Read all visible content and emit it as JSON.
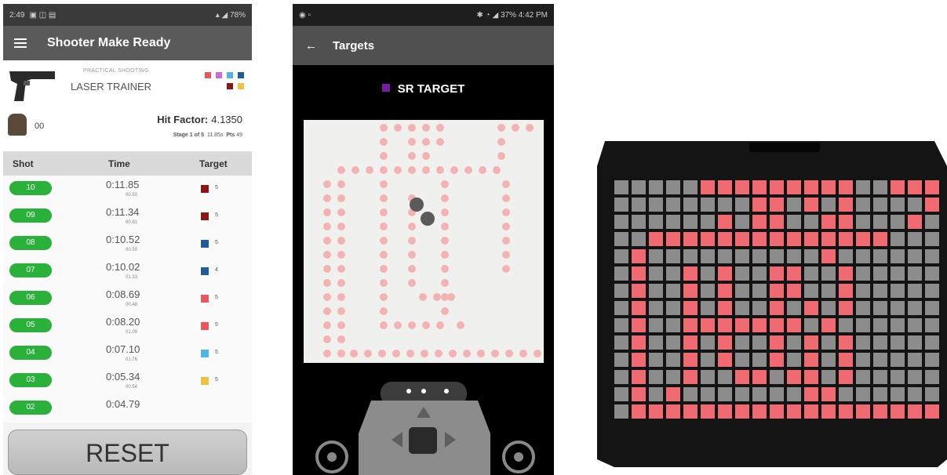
{
  "phone1": {
    "status": {
      "time": "2:49",
      "battery": "78%"
    },
    "app_title": "Shooter Make Ready",
    "subtitle": "PRACTICAL SHOOTING",
    "mode": "LASER TRAINER",
    "score": "00",
    "hit_factor_label": "Hit Factor:",
    "hit_factor": "4.1350",
    "stage": "Stage 1 of 5",
    "total_time": "11.85s",
    "pts_label": "Pts",
    "pts": "49",
    "headers": {
      "shot": "Shot",
      "time": "Time",
      "target": "Target"
    },
    "colors": [
      "#e8585e",
      "#c86cd6",
      "#4fb4e6",
      "#1e5c9a",
      "#8c1616",
      "#f2c040"
    ],
    "shots": [
      {
        "num": "10",
        "time": "0:11.85",
        "split": "00.50",
        "color": "#8c1616",
        "target": "5"
      },
      {
        "num": "09",
        "time": "0:11.34",
        "split": "00.81",
        "color": "#8c1616",
        "target": "5"
      },
      {
        "num": "08",
        "time": "0:10.52",
        "split": "00.50",
        "color": "#1e5c9a",
        "target": "5"
      },
      {
        "num": "07",
        "time": "0:10.02",
        "split": "01.33",
        "color": "#1e5c9a",
        "target": "4"
      },
      {
        "num": "06",
        "time": "0:08.69",
        "split": "00.48",
        "color": "#e8585e",
        "target": "5"
      },
      {
        "num": "05",
        "time": "0:08.20",
        "split": "01.09",
        "color": "#e8585e",
        "target": "5"
      },
      {
        "num": "04",
        "time": "0:07.10",
        "split": "01.76",
        "color": "#4fb4e6",
        "target": "5"
      },
      {
        "num": "03",
        "time": "0:05.34",
        "split": "00.54",
        "color": "#f2c040",
        "target": "5"
      },
      {
        "num": "02",
        "time": "0:04.79",
        "split": "",
        "color": "#cccccc",
        "target": ""
      }
    ],
    "reset_label": "RESET"
  },
  "phone2": {
    "status": {
      "time": "4:42 PM",
      "battery": "37%"
    },
    "app_title": "Targets",
    "target_title": "SR TARGET",
    "target_color": "#7a1aa6"
  },
  "device": {
    "on_color": "#f06a72",
    "off_color": "#8c8c8c"
  }
}
